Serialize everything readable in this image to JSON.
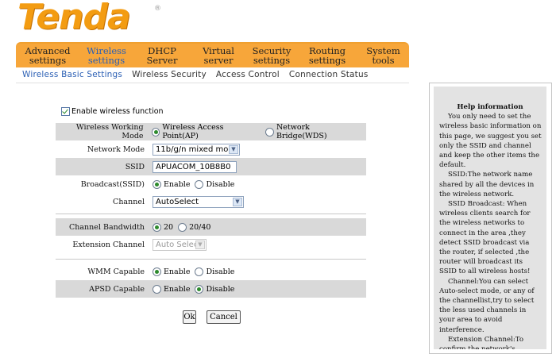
{
  "brand": {
    "name": "Tenda",
    "reg": "®"
  },
  "nav": [
    {
      "label": "Advanced\nsettings",
      "active": false
    },
    {
      "label": "Wireless\nsettings",
      "active": true
    },
    {
      "label": "DHCP\nServer",
      "active": false
    },
    {
      "label": "Virtual\nserver",
      "active": false
    },
    {
      "label": "Security\nsettings",
      "active": false
    },
    {
      "label": "Routing\nsettings",
      "active": false
    },
    {
      "label": "System\ntools",
      "active": false
    }
  ],
  "subnav": [
    {
      "label": "Wireless Basic Settings",
      "active": true
    },
    {
      "label": "Wireless Security",
      "active": false
    },
    {
      "label": "Access Control",
      "active": false
    },
    {
      "label": "Connection Status",
      "active": false
    }
  ],
  "form": {
    "enable_label": "Enable wireless function",
    "mode": {
      "label": "Wireless Working Mode",
      "opt1": "Wireless Access Point(AP)",
      "opt2": "Network Bridge(WDS)"
    },
    "network_mode": {
      "label": "Network Mode",
      "value": "11b/g/n mixed mode"
    },
    "ssid": {
      "label": "SSID",
      "value": "APUACOM_10B8B0"
    },
    "broadcast": {
      "label": "Broadcast(SSID)",
      "opt1": "Enable",
      "opt2": "Disable"
    },
    "channel": {
      "label": "Channel",
      "value": "AutoSelect"
    },
    "bandwidth": {
      "label": "Channel Bandwidth",
      "opt1": "20",
      "opt2": "20/40"
    },
    "ext_channel": {
      "label": "Extension Channel",
      "value": "Auto Select"
    },
    "wmm": {
      "label": "WMM Capable",
      "opt1": "Enable",
      "opt2": "Disable"
    },
    "apsd": {
      "label": "APSD Capable",
      "opt1": "Enable",
      "opt2": "Disable"
    },
    "ok_label": "Ok",
    "cancel_label": "Cancel"
  },
  "help": {
    "title": "Help information",
    "body": "    You only need to set the wireless basic information on this page, we suggest you set only the SSID and channel and keep the other items the default.\n    SSID:The network name shared by all the devices in the wireless network.\n    SSID Broadcast: When wireless clients search for the wireless networks to connect in the area ,they detect SSID broadcast via the router, if selected ,the router will broadcast its SSID to all wireless hosts!\n    Channel:You can select Auto-select mode, or any of the channellist,try to select the less used channels in your area to avoid interference.\n    Extension Channel:To confirm the network's frequency range in"
  },
  "colors": {
    "accent": "#f7a63a",
    "active_link": "#2b5fb4",
    "brand": "#f39c12"
  }
}
